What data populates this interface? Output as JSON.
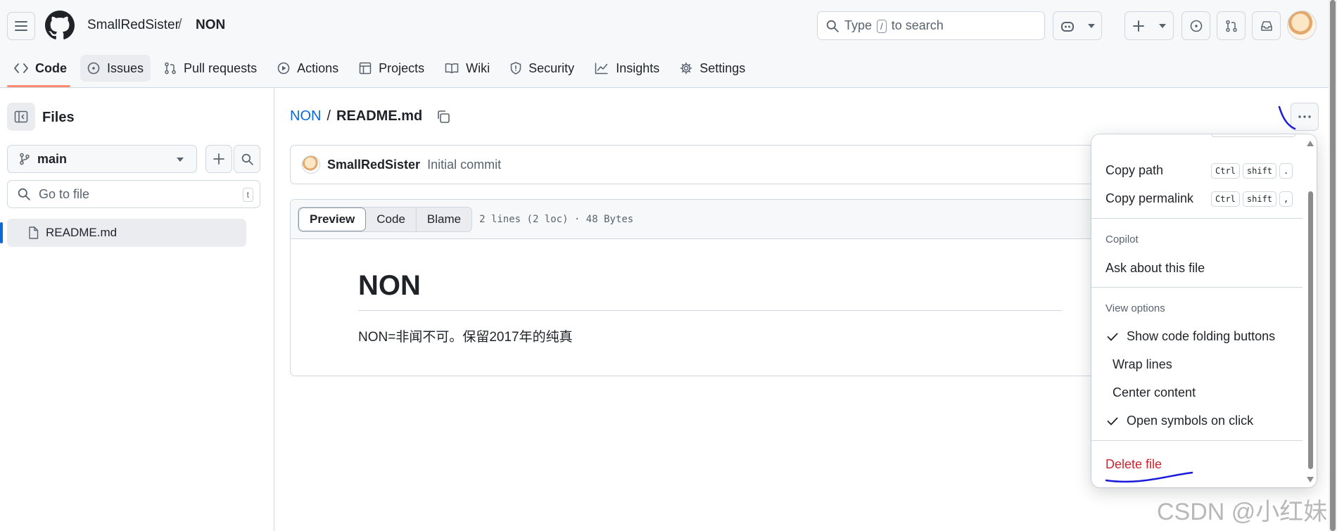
{
  "header": {
    "owner": "SmallRedSister",
    "separator": "/",
    "repo": "NON",
    "search": {
      "prefix": "Type",
      "key": "/",
      "suffix": "to search"
    }
  },
  "tabs": [
    {
      "label": "Code",
      "icon": "code-icon"
    },
    {
      "label": "Issues",
      "icon": "issue-opened-icon"
    },
    {
      "label": "Pull requests",
      "icon": "git-pull-request-icon"
    },
    {
      "label": "Actions",
      "icon": "play-icon"
    },
    {
      "label": "Projects",
      "icon": "table-icon"
    },
    {
      "label": "Wiki",
      "icon": "book-icon"
    },
    {
      "label": "Security",
      "icon": "shield-icon"
    },
    {
      "label": "Insights",
      "icon": "graph-icon"
    },
    {
      "label": "Settings",
      "icon": "gear-icon"
    }
  ],
  "sidebar": {
    "title": "Files",
    "branch": "main",
    "goto_placeholder": "Go to file",
    "goto_key": "t",
    "files": [
      {
        "name": "README.md"
      }
    ]
  },
  "file": {
    "path_repo": "NON",
    "path_sep": "/",
    "path_file": "README.md",
    "commit_author": "SmallRedSister",
    "commit_message": "Initial commit",
    "view_tabs": [
      "Preview",
      "Code",
      "Blame"
    ],
    "meta": "2 lines (2 loc) · 48 Bytes",
    "heading": "NON",
    "body": "NON=非闻不可。保留2017年的纯真"
  },
  "menu": {
    "copy_path": "Copy path",
    "copy_path_keys": [
      "Ctrl",
      "shift",
      "."
    ],
    "copy_permalink": "Copy permalink",
    "copy_permalink_keys": [
      "Ctrl",
      "shift",
      ","
    ],
    "group_copilot": "Copilot",
    "ask": "Ask about this file",
    "group_view": "View options",
    "opt_folding": "Show code folding buttons",
    "opt_wrap": "Wrap lines",
    "opt_center": "Center content",
    "opt_symbols": "Open symbols on click",
    "delete": "Delete file",
    "checked": {
      "folding": true,
      "wrap": false,
      "center": false,
      "symbols": true
    }
  },
  "watermark": "CSDN @小红妹",
  "colors": {
    "accent": "#0969da",
    "danger": "#d1242f",
    "tab_underline": "#fd8c73",
    "annotation": "#1a1adb"
  }
}
